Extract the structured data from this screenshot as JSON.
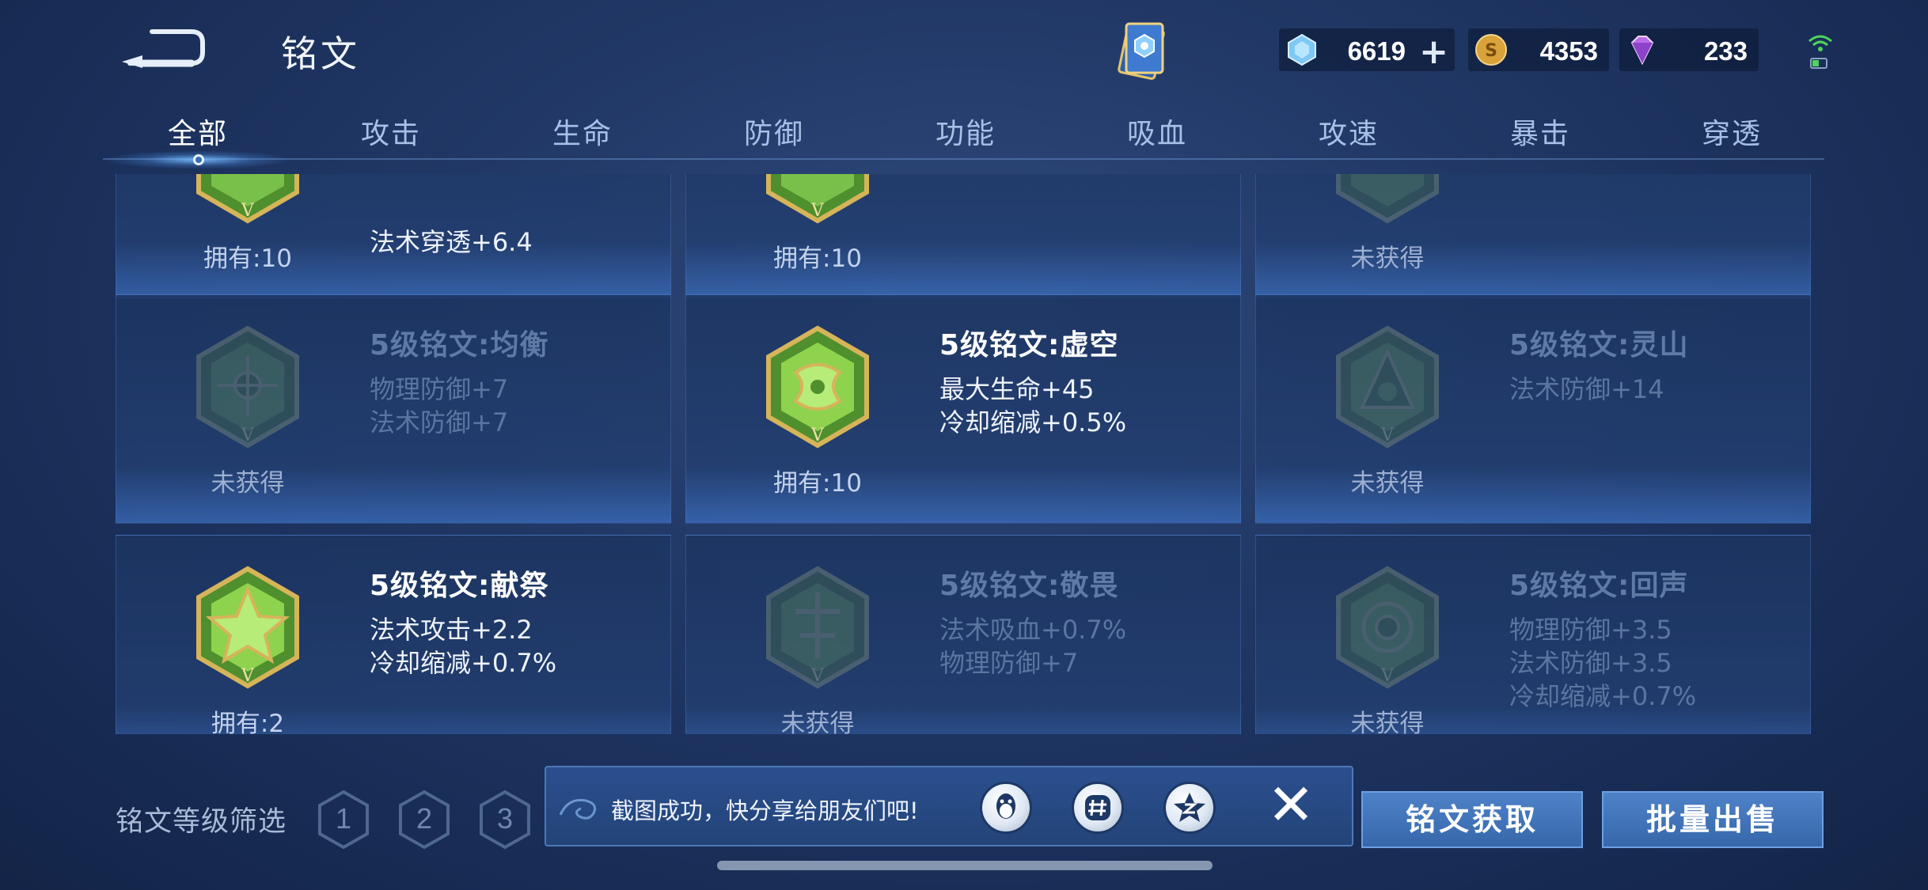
{
  "header": {
    "title": "铭文",
    "currencies": [
      {
        "name": "diamond",
        "value": "6619",
        "add_label": "+"
      },
      {
        "name": "gold-coin",
        "value": "4353"
      },
      {
        "name": "gem",
        "value": "233"
      }
    ]
  },
  "tabs": [
    {
      "label": "全部",
      "active": true
    },
    {
      "label": "攻击"
    },
    {
      "label": "生命"
    },
    {
      "label": "防御"
    },
    {
      "label": "功能"
    },
    {
      "label": "吸血"
    },
    {
      "label": "攻速"
    },
    {
      "label": "暴击"
    },
    {
      "label": "穿透"
    }
  ],
  "cards": [
    {
      "name": "",
      "stats": [
        "法术穿透+6.4"
      ],
      "count": "拥有:10",
      "owned": true
    },
    {
      "name": "",
      "stats": [],
      "count": "拥有:10",
      "owned": true
    },
    {
      "name": "",
      "stats": [],
      "count": "未获得",
      "owned": false
    },
    {
      "name": "5级铭文:均衡",
      "stats": [
        "物理防御+7",
        "法术防御+7"
      ],
      "count": "未获得",
      "owned": false
    },
    {
      "name": "5级铭文:虚空",
      "stats": [
        "最大生命+45",
        "冷却缩减+0.5%"
      ],
      "count": "拥有:10",
      "owned": true
    },
    {
      "name": "5级铭文:灵山",
      "stats": [
        "法术防御+14"
      ],
      "count": "未获得",
      "owned": false
    },
    {
      "name": "5级铭文:献祭",
      "stats": [
        "法术攻击+2.2",
        "冷却缩减+0.7%"
      ],
      "count": "拥有:2",
      "owned": true
    },
    {
      "name": "5级铭文:敬畏",
      "stats": [
        "法术吸血+0.7%",
        "物理防御+7"
      ],
      "count": "未获得",
      "owned": false
    },
    {
      "name": "5级铭文:回声",
      "stats": [
        "物理防御+3.5",
        "法术防御+3.5",
        "冷却缩减+0.7%"
      ],
      "count": "未获得",
      "owned": false
    }
  ],
  "filter": {
    "label": "铭文等级筛选",
    "levels": [
      "1",
      "2",
      "3"
    ]
  },
  "toast": {
    "message": "截图成功，快分享给朋友们吧!",
    "share_targets": [
      "qq-icon",
      "wechat-moments-icon",
      "qzone-icon"
    ],
    "close_label": "✕"
  },
  "buttons": {
    "get": "铭文获取",
    "sell": "批量出售"
  },
  "colors": {
    "background": "#1c3260",
    "tab_active": "#ffffff",
    "tab_inactive": "#a8c0e6",
    "button": "#3f72b8",
    "emblem_green": "#6fae3a",
    "emblem_gold": "#d6b45a"
  }
}
